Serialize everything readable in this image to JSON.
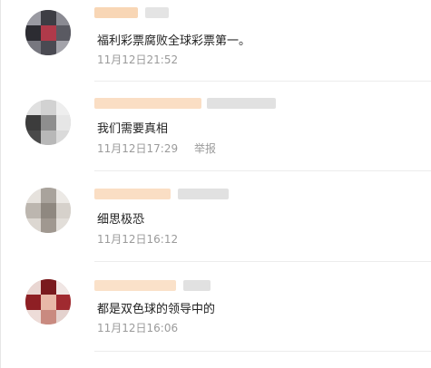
{
  "comments": [
    {
      "text": "福利彩票腐败全球彩票第一。",
      "time": "11月12日21:52",
      "report": ""
    },
    {
      "text": "我们需要真相",
      "time": "11月12日17:29",
      "report": "举报"
    },
    {
      "text": "细思极恐",
      "time": "11月12日16:12",
      "report": ""
    },
    {
      "text": "都是双色球的领导中的",
      "time": "11月12日16:06",
      "report": ""
    }
  ],
  "colors": {
    "body_text": "#222222",
    "meta_text": "#9b9b9b",
    "blurred_username": "#f6c89c",
    "divider": "#ececec"
  },
  "icons": [
    "blurred-avatar-icon"
  ]
}
